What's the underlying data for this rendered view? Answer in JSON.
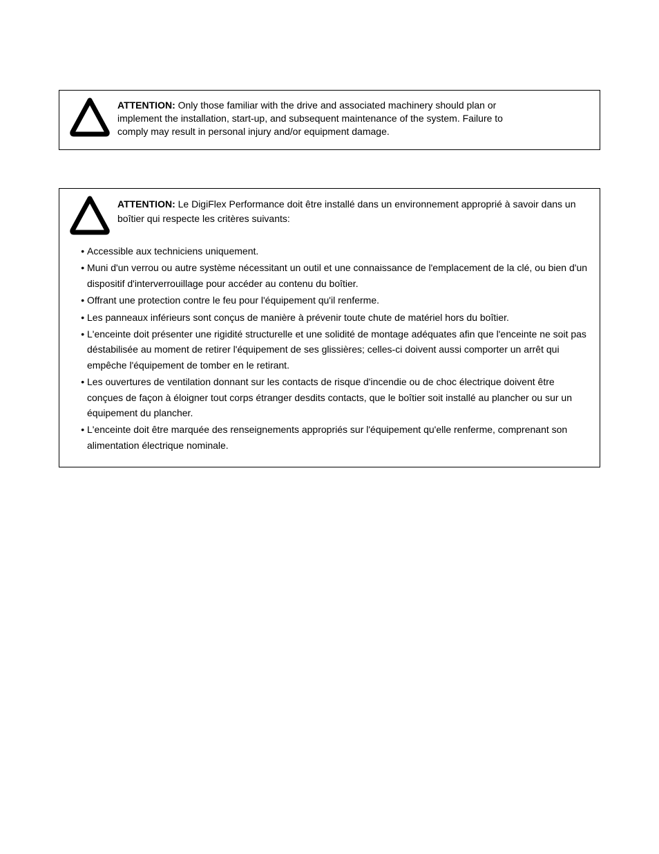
{
  "box1": {
    "bold_label": "ATTENTION:",
    "text_line1_rest": " Only those familiar with the drive and associated machinery should plan or",
    "text_line2": "implement the installation, start-up, and subsequent maintenance of the system. Failure to",
    "text_line3": "comply may result in personal injury and/or equipment damage."
  },
  "box2": {
    "bold_label": "ATTENTION:",
    "intro_rest": " Le DigiFlex Performance doit être installé dans un environnement approprié à savoir dans un boîtier qui respecte les critères suivants:",
    "bullets": [
      "Accessible aux techniciens uniquement.",
      "Muni d'un verrou ou autre système nécessitant un outil et une connaissance de l'emplacement de la clé, ou bien d'un dispositif d'interverrouillage pour accéder au contenu du boîtier.",
      "Offrant une protection contre le feu pour l'équipement qu'il renferme.",
      "Les panneaux inférieurs sont conçus de manière à prévenir toute chute de matériel hors du boîtier.",
      "L'enceinte doit présenter une rigidité structurelle et une solidité de montage adéquates afin que l'enceinte ne soit pas déstabilisée au moment de retirer l'équipement de ses glissières; celles-ci doivent aussi comporter un arrêt qui empêche l'équipement de tomber en le retirant.",
      "Les ouvertures de ventilation donnant sur les contacts de risque d'incendie ou de choc électrique doivent être conçues de façon à éloigner tout corps étranger desdits contacts, que le boîtier soit installé au plancher ou sur un équipement du plancher.",
      "L'enceinte doit être marquée des renseignements appropriés sur l'équipement qu'elle renferme, comprenant son alimentation électrique nominale."
    ]
  }
}
